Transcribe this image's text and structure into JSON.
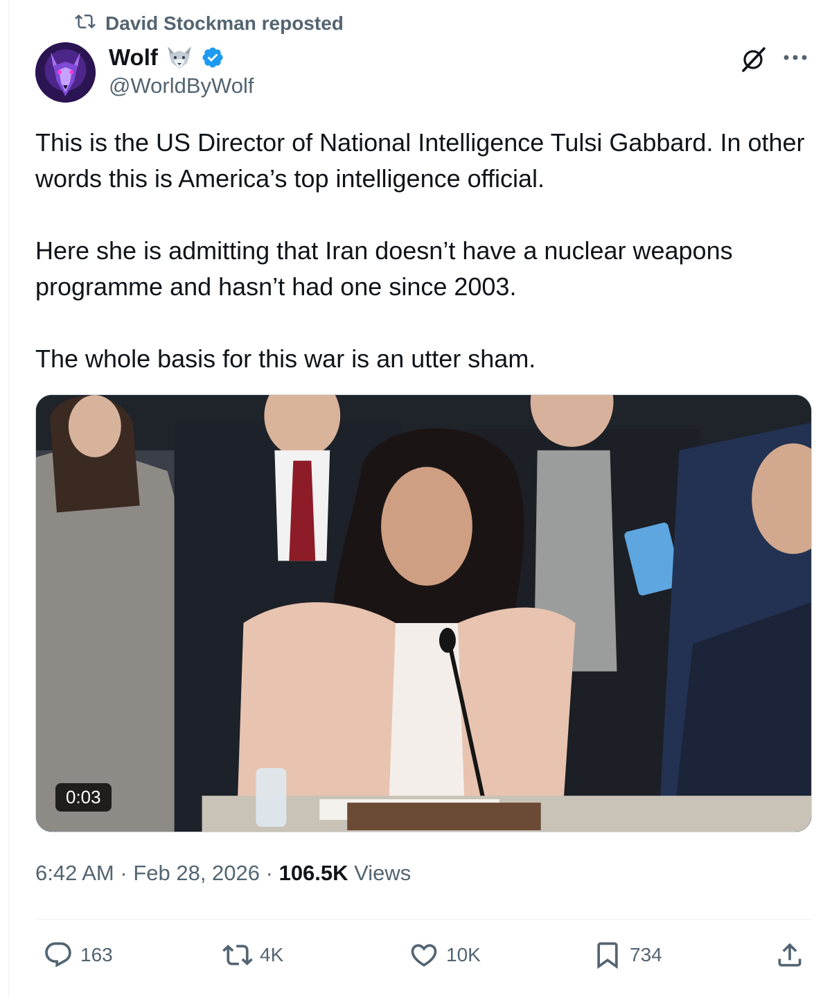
{
  "repost": {
    "text": "David Stockman reposted",
    "icon": "repost-icon"
  },
  "author": {
    "name": "Wolf",
    "emoji_icon": "wolf-emoji-icon",
    "verified_icon": "verified-badge-icon",
    "handle": "@WorldByWolf",
    "avatar_icon": "wolf-avatar"
  },
  "header_actions": {
    "grok_icon": "grok-icon",
    "more_icon": "more-icon"
  },
  "tweet": {
    "paragraphs": [
      "This is the US Director of National Intelligence Tulsi Gabbard. In other words this is America’s top intelligence official.",
      "Here she is admitting that Iran doesn’t have a nuclear weapons programme and hasn’t had one since 2003.",
      "The whole basis for this war is an utter sham."
    ]
  },
  "media": {
    "type": "video",
    "duration": "0:03"
  },
  "meta": {
    "time": "6:42 AM",
    "separator": " · ",
    "date": "Feb 28, 2026",
    "views_count": "106.5K",
    "views_label": " Views"
  },
  "actions": {
    "replies": "163",
    "reposts": "4K",
    "likes": "10K",
    "bookmarks": "734"
  },
  "colors": {
    "text_primary": "#0f1419",
    "text_secondary": "#536471",
    "verified_blue": "#1d9bf0",
    "divider": "#eff3f4"
  }
}
